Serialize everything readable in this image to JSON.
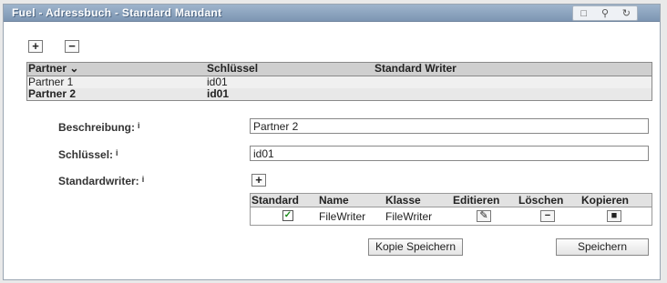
{
  "window": {
    "title": "Fuel - Adressbuch - Standard Mandant",
    "icons": [
      "window-icon",
      "search-icon",
      "refresh-icon"
    ]
  },
  "toolbar": {
    "add_label": "+",
    "remove_label": "−"
  },
  "partner_table": {
    "headers": {
      "partner": "Partner ⌄",
      "key": "Schlüssel",
      "writer": "Standard Writer"
    },
    "rows": [
      {
        "partner": "Partner 1",
        "key": "id01",
        "writer": ""
      },
      {
        "partner": "Partner 2",
        "key": "id01",
        "writer": ""
      }
    ],
    "selected_index": 1
  },
  "form": {
    "description_label": "Beschreibung:",
    "description_value": "Partner 2",
    "key_label": "Schlüssel:",
    "key_value": "id01",
    "writer_label": "Standardwriter:",
    "info_glyph": "i",
    "add_writer_label": "+"
  },
  "writer_table": {
    "headers": {
      "standard": "Standard",
      "name": "Name",
      "klasse": "Klasse",
      "edit": "Editieren",
      "delete": "Löschen",
      "copy": "Kopieren"
    },
    "rows": [
      {
        "standard": true,
        "name": "FileWriter",
        "klasse": "FileWriter"
      }
    ]
  },
  "actions": {
    "copy_save": "Kopie Speichern",
    "save": "Speichern"
  }
}
